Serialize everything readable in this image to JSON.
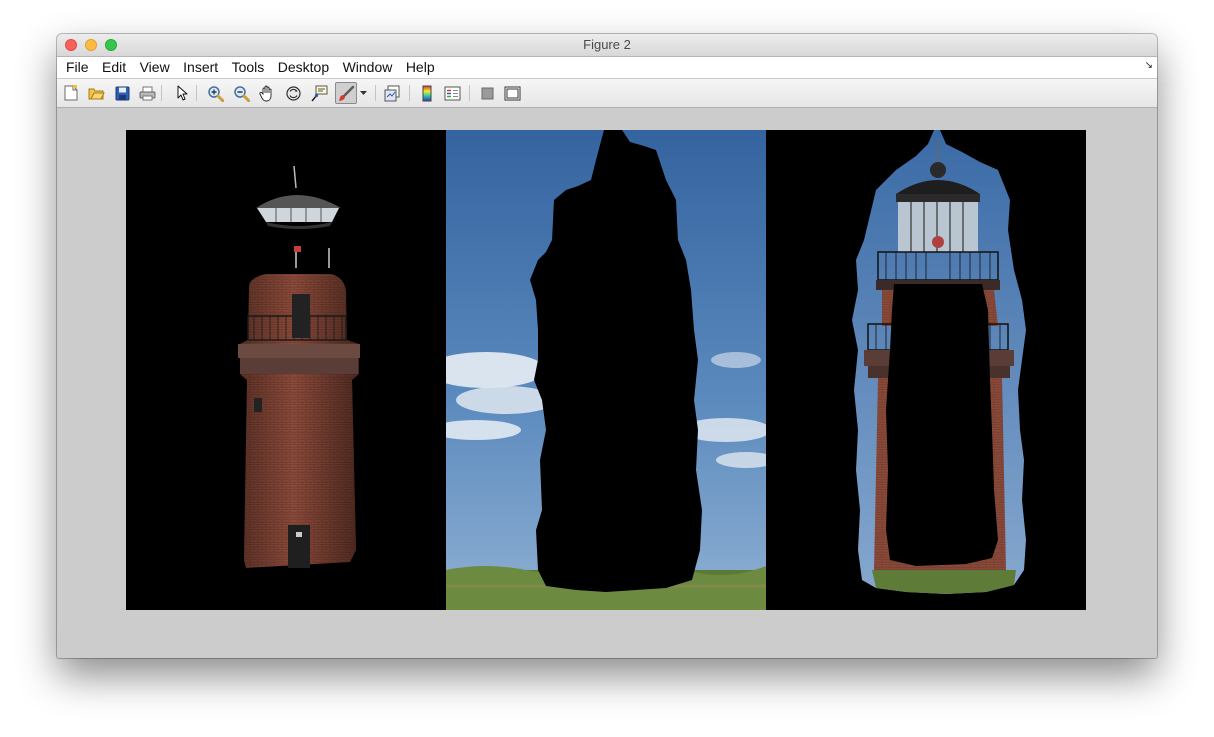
{
  "window": {
    "title": "Figure 2"
  },
  "menu": {
    "items": [
      "File",
      "Edit",
      "View",
      "Insert",
      "Tools",
      "Desktop",
      "Window",
      "Help"
    ]
  },
  "toolbar": {
    "buttons": [
      "new-figure-icon",
      "open-file-icon",
      "save-figure-icon",
      "print-figure-icon",
      "edit-plot-icon",
      "zoom-in-icon",
      "zoom-out-icon",
      "pan-icon",
      "rotate-3d-icon",
      "data-cursor-icon",
      "brush-icon",
      "brush-dropdown-icon",
      "link-plot-icon",
      "insert-colorbar-icon",
      "insert-legend-icon",
      "hide-plot-tools-icon",
      "show-plot-tools-icon"
    ]
  },
  "figure": {
    "panels": [
      "lighthouse-foreground-segment",
      "sky-background-segment",
      "lighthouse-refined-segment"
    ],
    "sky_color": "#3e74b1",
    "grass_color": "#5c7a36",
    "brick_color": "#8a4a3a"
  }
}
